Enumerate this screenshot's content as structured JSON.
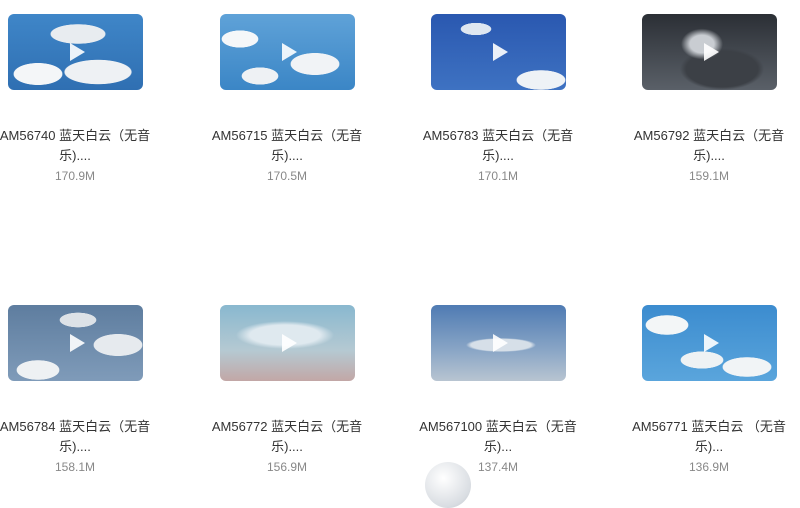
{
  "items": [
    {
      "title": "AM56740 蓝天白云（无音乐)....",
      "size": "170.9M"
    },
    {
      "title": "AM56715 蓝天白云（无音乐)....",
      "size": "170.5M"
    },
    {
      "title": "AM56783 蓝天白云（无音乐)....",
      "size": "170.1M"
    },
    {
      "title": "AM56792 蓝天白云（无音乐)....",
      "size": "159.1M"
    },
    {
      "title": "AM56784 蓝天白云（无音乐)....",
      "size": "158.1M"
    },
    {
      "title": "AM56772 蓝天白云（无音乐)....",
      "size": "156.9M"
    },
    {
      "title": "AM567100 蓝天白云（无音乐)...",
      "size": "137.4M"
    },
    {
      "title": "AM56771 蓝天白云 （无音乐)...",
      "size": "136.9M"
    }
  ]
}
